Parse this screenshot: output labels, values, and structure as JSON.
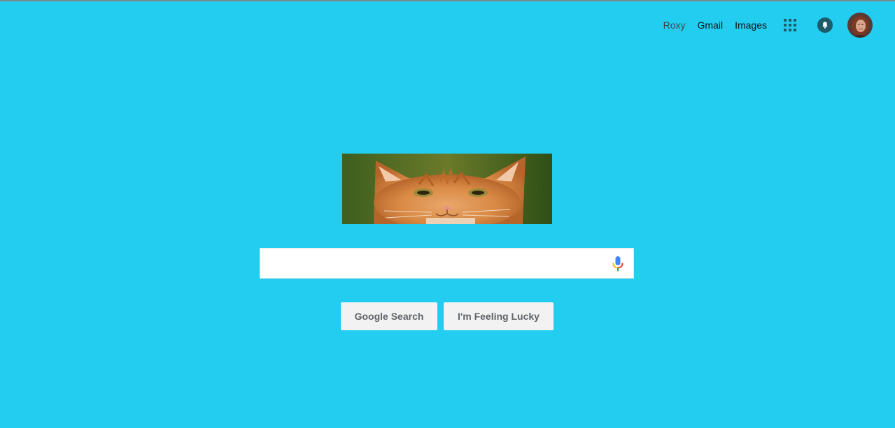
{
  "header": {
    "user_name": "Roxy",
    "links": [
      "Gmail",
      "Images"
    ],
    "icons": [
      "apps-grid-icon",
      "notifications-bell-icon",
      "avatar"
    ]
  },
  "logo": {
    "type": "cat-photo",
    "description_icon": "cat-photo-logo"
  },
  "search": {
    "value": "",
    "placeholder": "",
    "mic_icon": "microphone-icon"
  },
  "buttons": {
    "search_label": "Google Search",
    "lucky_label": "I'm Feeling Lucky"
  },
  "colors": {
    "background": "#22cdf0",
    "button_bg": "#f2f2f2",
    "button_text": "#5f6368",
    "icon_dark": "#1e5b68"
  }
}
